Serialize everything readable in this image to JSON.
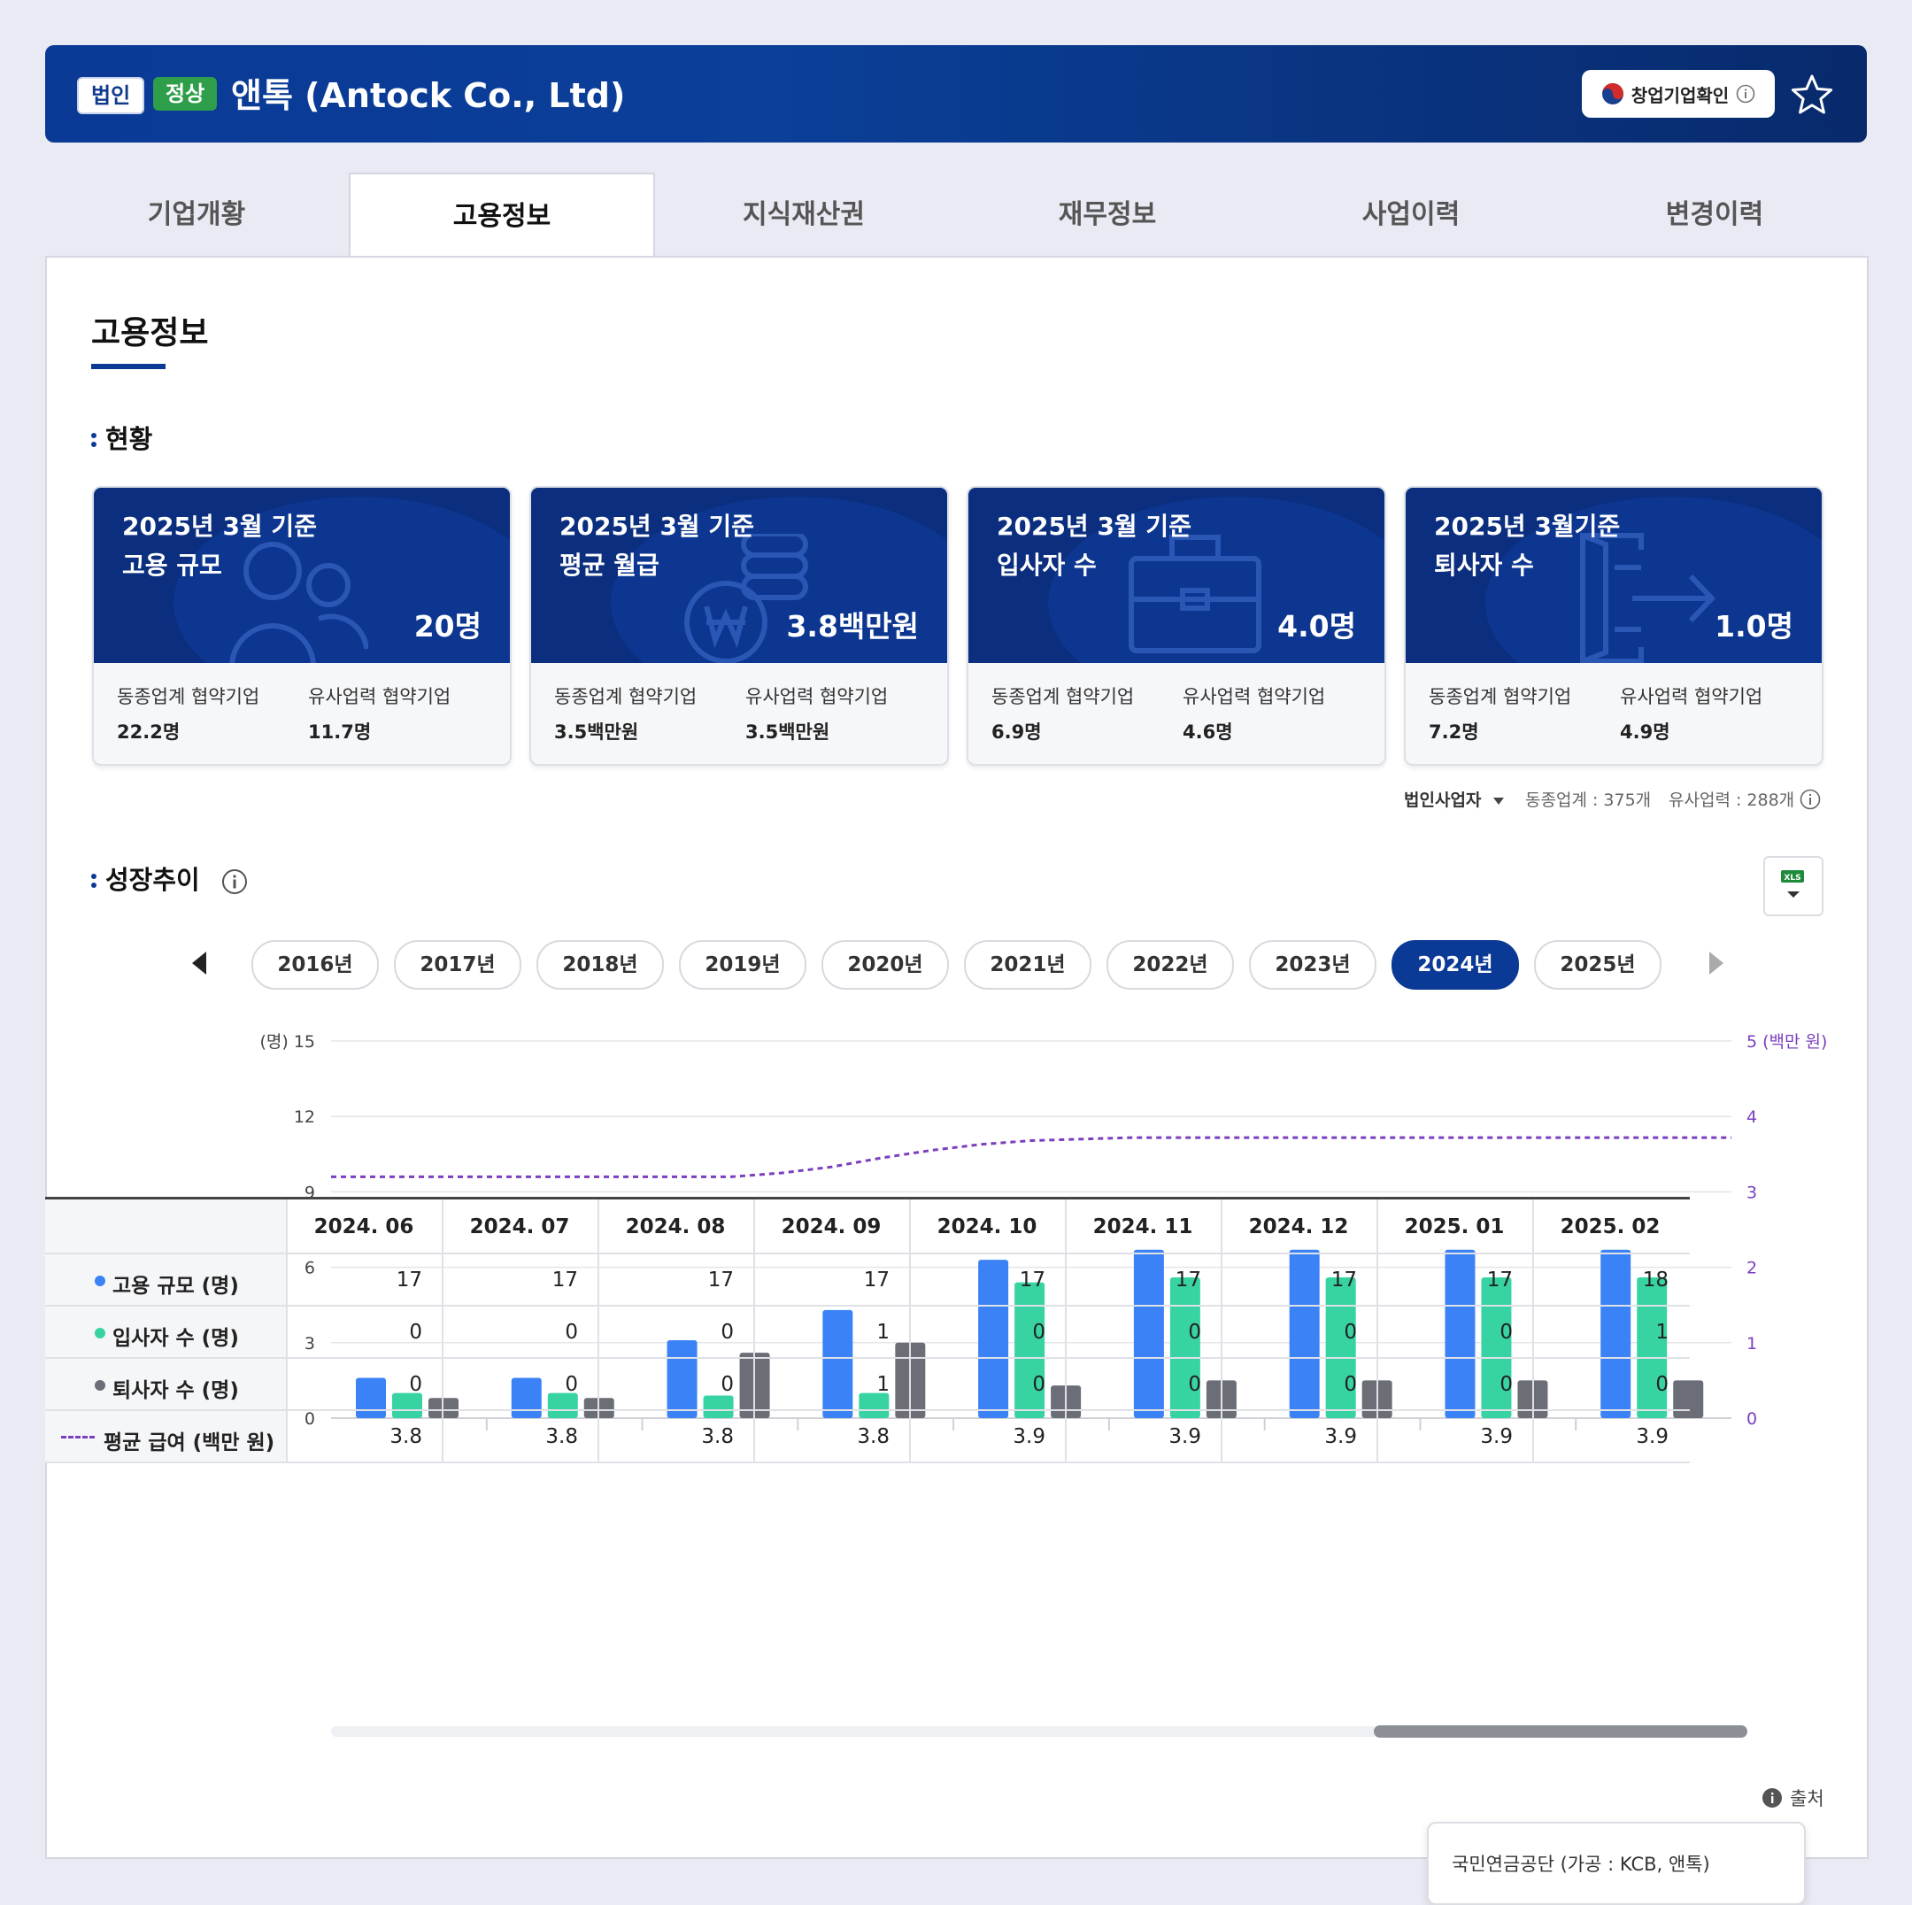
{
  "header": {
    "badge_corp": "법인",
    "badge_status": "정상",
    "company_name": "앤톡 (Antock Co., Ltd)",
    "startup_button": "창업기업확인"
  },
  "tabs": [
    {
      "label": "기업개황"
    },
    {
      "label": "고용정보"
    },
    {
      "label": "지식재산권"
    },
    {
      "label": "재무정보"
    },
    {
      "label": "사업이력"
    },
    {
      "label": "변경이력"
    }
  ],
  "page_title": "고용정보",
  "status_section": {
    "title": "현황",
    "cards": [
      {
        "line1": "2025년 3월 기준",
        "line2": "고용 규모",
        "value": "20명",
        "peer_label": "동종업계 협약기업",
        "peer_value": "22.2명",
        "similar_label": "유사업력 협약기업",
        "similar_value": "11.7명",
        "icon": "people-icon"
      },
      {
        "line1": "2025년 3월 기준",
        "line2": "평균 월급",
        "value": "3.8백만원",
        "peer_label": "동종업계 협약기업",
        "peer_value": "3.5백만원",
        "similar_label": "유사업력 협약기업",
        "similar_value": "3.5백만원",
        "icon": "coins-icon"
      },
      {
        "line1": "2025년 3월 기준",
        "line2": "입사자 수",
        "value": "4.0명",
        "peer_label": "동종업계 협약기업",
        "peer_value": "6.9명",
        "similar_label": "유사업력 협약기업",
        "similar_value": "4.6명",
        "icon": "briefcase-icon"
      },
      {
        "line1": "2025년 3월기준",
        "line2": "퇴사자 수",
        "value": "1.0명",
        "peer_label": "동종업계 협약기업",
        "peer_value": "7.2명",
        "similar_label": "유사업력 협약기업",
        "similar_value": "4.9명",
        "icon": "exit-icon"
      }
    ],
    "filter_label": "법인사업자",
    "peer_count": "동종업계 : 375개",
    "similar_count": "유사업력 : 288개"
  },
  "growth_section": {
    "title": "성장추이",
    "xls_label": "XLS",
    "years": [
      "2016년",
      "2017년",
      "2018년",
      "2019년",
      "2020년",
      "2021년",
      "2022년",
      "2023년",
      "2024년",
      "2025년"
    ],
    "selected_year": "2024년"
  },
  "chart_data": {
    "type": "bar",
    "categories": [
      "2024. 06",
      "2024. 07",
      "2024. 08",
      "2024. 09",
      "2024. 10",
      "2024. 11",
      "2024. 12",
      "2025. 01",
      "2025. 02"
    ],
    "y_left_label": "(명)",
    "y_right_label": "(백만 원)",
    "ylim_left": [
      0,
      15
    ],
    "ylim_right": [
      0,
      5
    ],
    "y_left_ticks": [
      "0",
      "3",
      "6",
      "9",
      "12",
      "15"
    ],
    "y_right_ticks": [
      "0",
      "1",
      "2",
      "3",
      "4",
      "5"
    ],
    "series": [
      {
        "name": "고용 규모 (명)",
        "color": "#3b82f6",
        "bar_values": [
          1.6,
          1.6,
          3.1,
          4.3,
          6.3,
          6.7,
          6.7,
          6.7,
          6.7
        ],
        "table_values": [
          "17",
          "17",
          "17",
          "17",
          "17",
          "17",
          "17",
          "17",
          "18"
        ]
      },
      {
        "name": "입사자 수 (명)",
        "color": "#38d3a3",
        "bar_values": [
          1.0,
          1.0,
          0.9,
          1.0,
          5.4,
          5.6,
          5.6,
          5.6,
          5.6
        ],
        "table_values": [
          "0",
          "0",
          "0",
          "1",
          "0",
          "0",
          "0",
          "0",
          "1"
        ]
      },
      {
        "name": "퇴사자 수 (명)",
        "color": "#6b6e76",
        "bar_values": [
          0.8,
          0.8,
          2.6,
          3.0,
          1.3,
          1.5,
          1.5,
          1.5,
          1.5
        ],
        "table_values": [
          "0",
          "0",
          "0",
          "1",
          "0",
          "0",
          "0",
          "0",
          "0"
        ]
      },
      {
        "name": "평균 급여 (백만 원)",
        "color": "#7b3fbf",
        "line_values": [
          3.2,
          3.2,
          3.2,
          3.2,
          3.2,
          3.2,
          3.2,
          3.2,
          3.2,
          3.25,
          3.33,
          3.45,
          3.55,
          3.63,
          3.68,
          3.7,
          3.72,
          3.72,
          3.72,
          3.72,
          3.72,
          3.72,
          3.72,
          3.72,
          3.72,
          3.72,
          3.72,
          3.72,
          3.72
        ],
        "table_values": [
          "3.8",
          "3.8",
          "3.8",
          "3.8",
          "3.9",
          "3.9",
          "3.9",
          "3.9",
          "3.9"
        ]
      }
    ]
  },
  "source": {
    "label": "출처",
    "text": "국민연금공단 (가공 : KCB, 앤톡)"
  }
}
